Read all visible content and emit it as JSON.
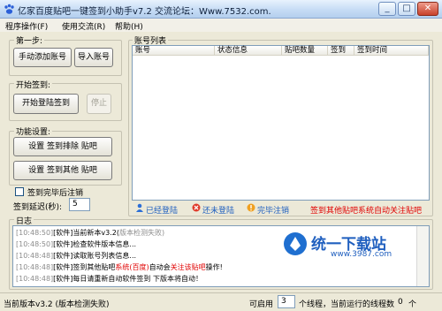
{
  "window": {
    "title": "亿家百度贴吧一键签到小助手v7.2 交流论坛：Www.7532.com.",
    "minimize": "_",
    "maximize": "□",
    "close": "✕"
  },
  "menu": {
    "items": [
      "程序操作(F)",
      "使用交流(R)",
      "帮助(H)"
    ]
  },
  "step1": {
    "title": "第一步:",
    "manual_add": "手动添加账号",
    "import": "导入账号"
  },
  "signin": {
    "title": "开始签到:",
    "start": "开始登陆签到",
    "stop": "停止"
  },
  "features": {
    "title": "功能设置:",
    "exclude": "设置 签到排除 贴吧",
    "other": "设置 签到其他 贴吧"
  },
  "options": {
    "close_after": "签到完毕后注销",
    "delay_label": "签到延迟(秒):",
    "delay_value": "5"
  },
  "accounts": {
    "title": "账号列表",
    "columns": [
      "账号",
      "状态信息",
      "贴吧数量",
      "签到",
      "签到时间"
    ]
  },
  "links": {
    "logged_in": "已经登陆",
    "not_logged": "还未登陆",
    "done_logout": "完毕注销",
    "promo": "签到其他贴吧系统自动关注贴吧"
  },
  "log": {
    "title": "日志",
    "lines": [
      {
        "time": "[10:48:50]",
        "text": "[软件]当前新本v3.2(",
        "tail": "版本检测失败)"
      },
      {
        "time": "[10:48:50]",
        "text": "[软件]检查软件版本信息...",
        "tail": ""
      },
      {
        "time": "[10:48:48]",
        "text": "[软件]读取账号列表信息...",
        "tail": ""
      },
      {
        "time": "[10:48:48]",
        "text": "[软件]签到其他贴吧",
        "red": "系统(百度)",
        "text2": "自动会",
        "red2": "关注该贴吧",
        "text3": "操作!"
      },
      {
        "time": "[10:48:48]",
        "text": "[软件]每日请重新自动软件签到 下版本将自动！",
        "tail": ""
      }
    ]
  },
  "status": {
    "version": "当前版本v3.2 (版本检测失败)",
    "enable_label": "可启用",
    "threads": "3",
    "threads_label": "个线程，",
    "running_label": "当前运行的线程数",
    "running": "0",
    "running_unit": "个"
  },
  "watermark": {
    "brand": "统一下载站",
    "url": "www.3987.com"
  },
  "colors": {
    "accent": "#1f5fbf",
    "red": "#e00000",
    "bg": "#ece9d8"
  }
}
